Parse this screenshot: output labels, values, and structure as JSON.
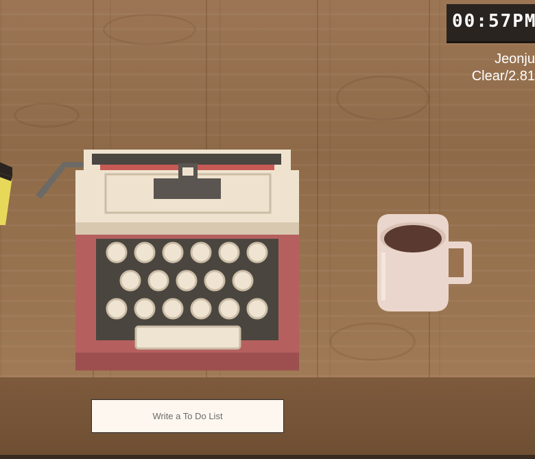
{
  "clock": {
    "time": "00:57PM"
  },
  "weather": {
    "city": "Jeonju",
    "summary": "Clear/2.81"
  },
  "todo": {
    "placeholder": "Write a To Do List",
    "value": ""
  },
  "colors": {
    "desk": "#9a7350",
    "desk_edge": "#7d5a3c",
    "clock_bg": "#2a2420",
    "typewriter_body": "#b5605f",
    "typewriter_cream": "#efe3cf",
    "key_fill": "#efe4d2",
    "coffee": "#5a3a30",
    "mug": "#ead6cc",
    "notebook_yellow": "#e8d85a"
  },
  "icons": [
    "typewriter-icon",
    "coffee-mug-icon",
    "notebook-icon"
  ]
}
